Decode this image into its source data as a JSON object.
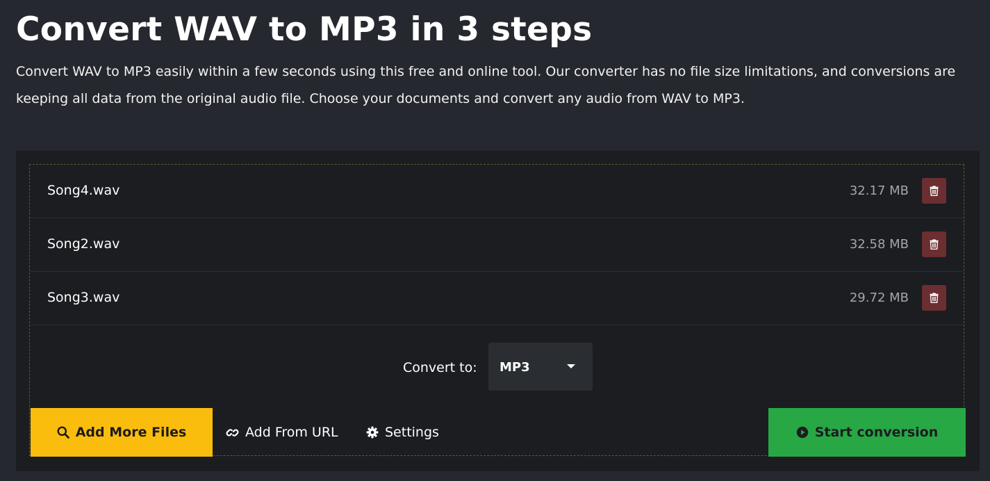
{
  "page": {
    "title": "Convert WAV to MP3 in 3 steps",
    "intro": "Convert WAV to MP3 easily within a few seconds using this free and online tool. Our converter has no file size limitations, and conversions are keeping all data from the original audio file. Choose your documents and convert any audio from WAV to MP3."
  },
  "files": [
    {
      "name": "Song4.wav",
      "size": "32.17 MB"
    },
    {
      "name": "Song2.wav",
      "size": "32.58 MB"
    },
    {
      "name": "Song3.wav",
      "size": "29.72 MB"
    }
  ],
  "convert": {
    "label": "Convert to:",
    "selected_format": "MP3"
  },
  "actions": {
    "add_files": "Add More Files",
    "add_url": "Add From URL",
    "settings": "Settings",
    "start": "Start conversion"
  },
  "icons": {
    "delete": "trash-icon",
    "add_files": "search-icon",
    "add_url": "link-icon",
    "settings": "gear-icon",
    "start": "play-circle-icon",
    "select": "caret-down-icon"
  },
  "colors": {
    "background": "#25282e",
    "panel": "#1b1d21",
    "add_button": "#fbbd0d",
    "start_button": "#28a745",
    "delete_button": "#6b2e31"
  }
}
